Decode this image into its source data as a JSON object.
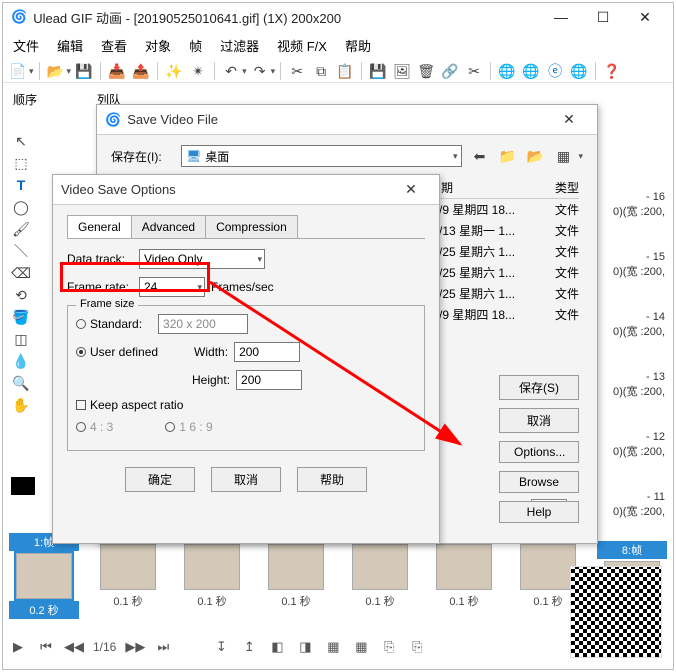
{
  "main": {
    "title": "Ulead GIF 动画 - [20190525010641.gif] (1X) 200x200",
    "menus": [
      "文件",
      "编辑",
      "查看",
      "对象",
      "帧",
      "过滤器",
      "视频 F/X",
      "帮助"
    ]
  },
  "seq": {
    "a": "顺序",
    "b": "列队"
  },
  "save": {
    "title": "Save Video File",
    "save_in_lbl": "保存在(I):",
    "location": "桌面",
    "cols": {
      "date": "日期",
      "type": "类型"
    },
    "rows": [
      {
        "d": "/5/9 星期四 18...",
        "t": "文件"
      },
      {
        "d": "/5/13 星期一 1...",
        "t": "文件"
      },
      {
        "d": "/5/25 星期六 1...",
        "t": "文件"
      },
      {
        "d": "/5/25 星期六 1...",
        "t": "文件"
      },
      {
        "d": "/5/25 星期六 1...",
        "t": "文件"
      },
      {
        "d": "/5/9 星期四 18...",
        "t": "文件"
      }
    ],
    "btns": {
      "save": "保存(S)",
      "cancel": "取消",
      "options": "Options...",
      "browse": "Browse",
      "help": "Help"
    }
  },
  "opt": {
    "title": "Video Save Options",
    "tabs": [
      "General",
      "Advanced",
      "Compression"
    ],
    "data_track_lbl": "Data track:",
    "data_track_val": "Video Only",
    "frame_rate_lbl": "Frame rate:",
    "frame_rate_val": "24",
    "frame_rate_unit": "Frames/sec",
    "frame_size_cap": "Frame size",
    "standard_lbl": "Standard:",
    "standard_val": "320 x 200",
    "user_defined_lbl": "User defined",
    "width_lbl": "Width:",
    "width_val": "200",
    "height_lbl": "Height:",
    "height_val": "200",
    "keep_aspect": "Keep aspect ratio",
    "ratio43": "4 : 3",
    "ratio169": "1 6 : 9",
    "ok": "确定",
    "cancel": "取消",
    "help": "帮助"
  },
  "right": [
    {
      "a": "- 16",
      "b": "0)(宽 :200,"
    },
    {
      "a": "- 15",
      "b": "0)(宽 :200,"
    },
    {
      "a": "- 14",
      "b": "0)(宽 :200,"
    },
    {
      "a": "- 13",
      "b": "0)(宽 :200,"
    },
    {
      "a": "- 12",
      "b": "0)(宽 :200,"
    },
    {
      "a": "- 11",
      "b": "0)(宽 :200,"
    }
  ],
  "frames": {
    "items": [
      {
        "n": "1:帧",
        "t": "0.2 秒",
        "sel": true
      },
      {
        "n": "",
        "t": "0.1 秒"
      },
      {
        "n": "",
        "t": "0.1 秒"
      },
      {
        "n": "",
        "t": "0.1 秒"
      },
      {
        "n": "",
        "t": "0.1 秒"
      },
      {
        "n": "",
        "t": "0.1 秒"
      },
      {
        "n": "",
        "t": "0.1 秒"
      },
      {
        "n": "8:帧",
        "t": ""
      }
    ]
  },
  "play": {
    "pos": "1/16"
  }
}
